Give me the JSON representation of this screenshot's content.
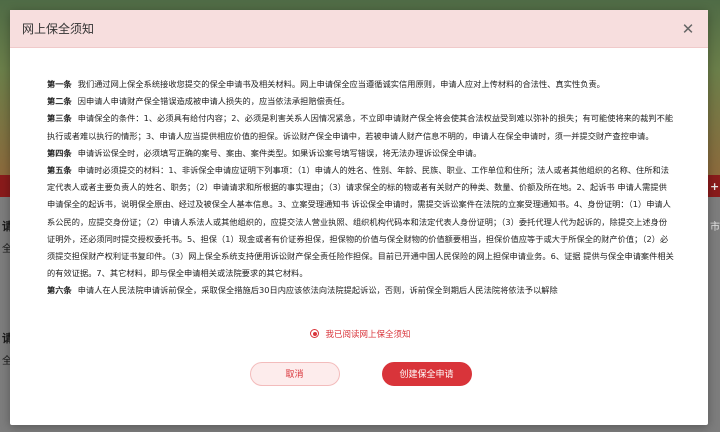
{
  "background": {
    "fragments": [
      "请",
      "全",
      "请",
      "全",
      "+",
      "市"
    ]
  },
  "modal": {
    "title": "网上保全须知",
    "close_icon": "close-icon",
    "clauses": [
      {
        "label": "第一条",
        "text": "我们通过网上保全系统接收您提交的保全申请书及相关材料。网上申请保全应当遵循诚实信用原则，申请人应对上传材料的合法性、真实性负责。"
      },
      {
        "label": "第二条",
        "text": "因申请人申请财产保全错误造成被申请人损失的，应当依法承担赔偿责任。"
      },
      {
        "label": "第三条",
        "text": "申请保全的条件：1、必须具有给付内容；2、必须是利害关系人因情况紧急，不立即申请财产保全将会使其合法权益受到难以弥补的损失；有可能使将来的裁判不能执行或者难以执行的情形；3、申请人应当提供相应价值的担保。诉讼财产保全申请中，若被申请人财产信息不明的，申请人在保全申请时，须一并提交财产查控申请。"
      },
      {
        "label": "第四条",
        "text": "申请诉讼保全时，必须填写正确的案号、案由、案件类型。如果诉讼案号填写错误，将无法办理诉讼保全申请。"
      },
      {
        "label": "第五条",
        "text": "申请时必须提交的材料：1、非诉保全申请应证明下列事项：（1）申请人的姓名、性别、年龄、民族、职业、工作单位和住所；法人或者其他组织的名称、住所和法定代表人或者主要负责人的姓名、职务；（2）申请请求和所根据的事实理由；（3）请求保全的标的物或者有关财产的种类、数量、价额及所在地。2、起诉书 申请人需提供申请保全的起诉书，说明保全原由、经过及被保全人基本信息。3、立案受理通知书 诉讼保全申请时，需提交诉讼案件在法院的立案受理通知书。4、身份证明：（1）申请人系公民的，应提交身份证；（2）申请人系法人或其他组织的，应提交法人营业执照、组织机构代码本和法定代表人身份证明；（3）委托代理人代为起诉的，除提交上述身份证明外，还必须同时提交授权委托书。5、担保（1）现金或者有价证券担保，担保物的价值与保全财物的价值额要相当，担保价值应等于或大于所保全的财产价值；（2）必须提交担保财产权利证书复印件。（3）网上保全系统支持便用诉讼财产保全责任险作担保。目前已开通中国人民保险的网上担保申请业务。6、证据 提供与保全申请案件相关的有效证据。7、其它材料，即与保全申请相关或法院要求的其它材料。"
      },
      {
        "label": "第六条",
        "text": "申请人在人民法院申请诉前保全，采取保全措施后30日内应该依法向法院提起诉讼，否则，诉前保全到期后人民法院将依法予以解除"
      }
    ],
    "agree_label": "我已阅读网上保全须知",
    "cancel_label": "取消",
    "create_label": "创建保全申请",
    "accent_color": "#d9343a"
  }
}
